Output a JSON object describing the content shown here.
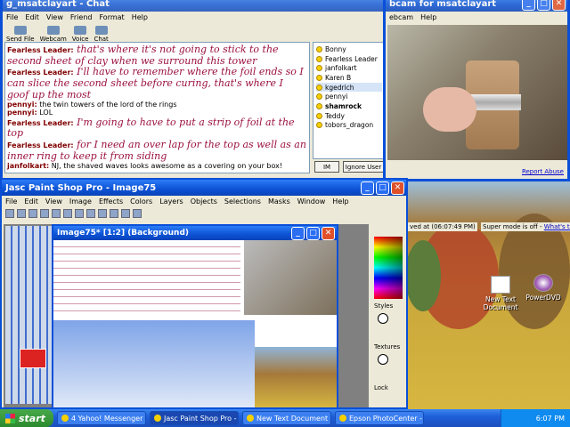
{
  "colors": {
    "accent": "#0a4fd8",
    "chat_red": "#9b1040",
    "taskbar": "#1f5fd8",
    "start": "#2b8a2d"
  },
  "messenger": {
    "title": "g_msatclayart - Chat",
    "menu": [
      "File",
      "Edit",
      "View",
      "Friend",
      "Format",
      "Help"
    ],
    "tools": [
      "Send File",
      "Webcam",
      "Voice",
      "Chat"
    ],
    "messages": [
      {
        "who": "Fearless Leader:",
        "text": "that's where it's not going to stick to the second sheet of clay when we surround this tower",
        "style": "big"
      },
      {
        "who": "Fearless Leader:",
        "text": "I'll have to remember where the foil ends so I can slice the second sheet before curing, that's where I goof up the most",
        "style": "big"
      },
      {
        "who": "pennyi:",
        "text": "the twin towers of the lord of the rings",
        "style": "small"
      },
      {
        "who": "pennyi:",
        "text": "LOL",
        "style": "small"
      },
      {
        "who": "Fearless Leader:",
        "text": "I'm going to have to put a strip of foil at the top",
        "style": "big"
      },
      {
        "who": "Fearless Leader:",
        "text": "for I need an over lap for the top as well as an inner ring to keep it from siding",
        "style": "big"
      },
      {
        "who": "janfolkart:",
        "text": "NJ, the shaved waves looks awesome as a covering on your box!",
        "style": "small"
      }
    ],
    "buddies": [
      {
        "name": "Bonny"
      },
      {
        "name": "Fearless Leader"
      },
      {
        "name": "janfolkart"
      },
      {
        "name": "Karen B"
      },
      {
        "name": "kgedrich",
        "selected": true
      },
      {
        "name": "pennyi"
      },
      {
        "name": "shamrock",
        "bold": true
      },
      {
        "name": "Teddy"
      },
      {
        "name": "tobors_dragon"
      }
    ],
    "im_button": "IM",
    "ignore_button": "Ignore User"
  },
  "webcam": {
    "title": "bcam for msatclayart",
    "menu": [
      "ebcam",
      "Help"
    ],
    "report": "Report Abuse",
    "saved": "ved at (06:07:49 PM)",
    "super": "Super mode is off -",
    "whats": "What's this?"
  },
  "psp": {
    "title": "Jasc Paint Shop Pro - Image75",
    "menu": [
      "File",
      "Edit",
      "View",
      "Image",
      "Effects",
      "Colors",
      "Layers",
      "Objects",
      "Selections",
      "Masks",
      "Window",
      "Help"
    ],
    "image_title": "Image75* [1:2] (Background)",
    "styles": "Styles",
    "textures": "Textures",
    "lock": "Lock"
  },
  "desktop_icons": [
    {
      "label": "New Text Document"
    },
    {
      "label": "PowerDVD"
    }
  ],
  "taskbar": {
    "start": "start",
    "tasks": [
      "4 Yahoo! Messenger",
      "Jasc Paint Shop Pro - ...",
      "New Text Document -...",
      "Epson PhotoCenter - ..."
    ],
    "clock": "6:07 PM"
  }
}
